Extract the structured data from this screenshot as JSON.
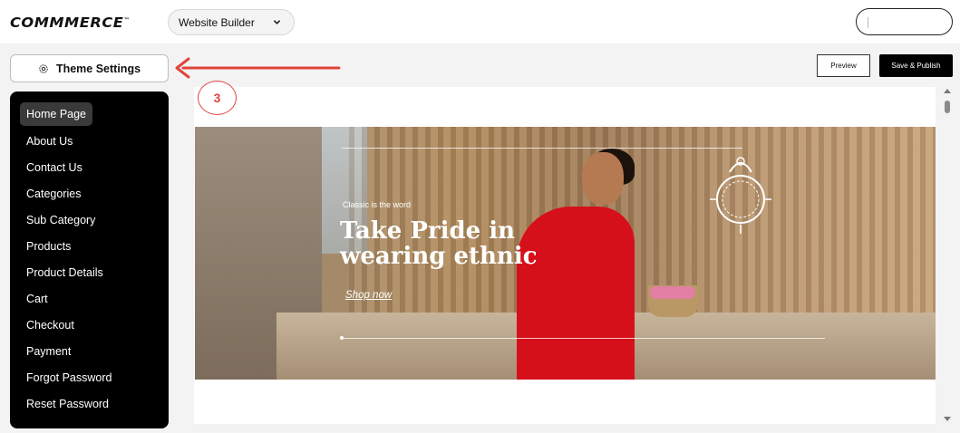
{
  "header": {
    "logo_text": "COMMMERCE",
    "logo_tm": "™",
    "site_select_value": "Website Builder"
  },
  "toolbar": {
    "theme_settings_label": "Theme Settings",
    "preview_label": "Preview",
    "publish_label": "Save & Publish",
    "step_number": "3"
  },
  "sidebar": {
    "items": [
      {
        "label": "Home Page",
        "active": true
      },
      {
        "label": "About Us"
      },
      {
        "label": "Contact Us"
      },
      {
        "label": "Categories"
      },
      {
        "label": "Sub Category"
      },
      {
        "label": "Products"
      },
      {
        "label": "Product Details"
      },
      {
        "label": "Cart"
      },
      {
        "label": "Checkout"
      },
      {
        "label": "Payment"
      },
      {
        "label": "Forgot Password"
      },
      {
        "label": "Reset Password"
      }
    ]
  },
  "hero": {
    "eyebrow": "Classic is the word",
    "headline": "Take Pride in wearing ethnic",
    "cta": "Shop now"
  },
  "colors": {
    "annotation_red": "#e0443e",
    "sidebar_bg": "#000000",
    "active_item_bg": "#3a3a3a",
    "saree_red": "#d6101b"
  }
}
